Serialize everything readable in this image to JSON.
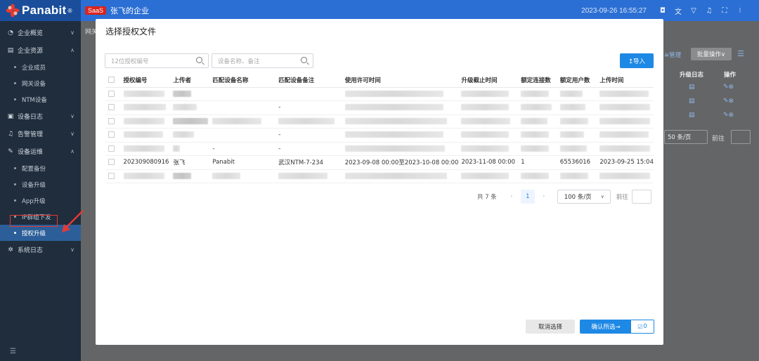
{
  "topbar": {
    "logo": "Panabit",
    "logo_reg": "®",
    "badge": "SaaS",
    "company": "张飞的企业",
    "datetime": "2023-09-26 16:55:27"
  },
  "sidebar": {
    "groups": [
      {
        "label": "企业概览",
        "icon": "gauge-icon"
      },
      {
        "label": "企业资源",
        "icon": "building-icon"
      },
      {
        "label": "设备日志",
        "icon": "log-icon"
      },
      {
        "label": "告警管理",
        "icon": "bell-icon"
      },
      {
        "label": "设备运维",
        "icon": "wrench-icon"
      },
      {
        "label": "系统日志",
        "icon": "gear-icon"
      }
    ],
    "resource_items": [
      "企业成员",
      "网关设备",
      "NTM设备"
    ],
    "ops_items": [
      "配置备份",
      "设备升级",
      "App升级",
      "IP群组下发",
      "授权升级"
    ],
    "bottom_icon": "menu-icon"
  },
  "background": {
    "breadcrumb": "网关",
    "manage_label": "≡管理",
    "batch_label": "批量操作∨",
    "col_upgrade_log": "升级日志",
    "col_ops": "操作",
    "page_size": "50 条/页",
    "goto": "前往"
  },
  "modal": {
    "title": "选择授权文件",
    "search1_placeholder": "12位授权编号",
    "search2_placeholder": "设备名称、备注",
    "import_label": "↥导入",
    "headers": [
      "授权编号",
      "上传者",
      "匹配设备名称",
      "匹配设备备注",
      "使用许可时间",
      "升级截止时间",
      "额定连接数",
      "额定用户数",
      "上传时间"
    ],
    "visible_row": {
      "id": "202309080916",
      "uploader": "张飞",
      "device_name": "Panabit",
      "device_note": "武汉NTM-7-234",
      "license_period": "2023-09-08 00:00至2023-10-08 00:00",
      "upgrade_deadline": "2023-11-08 00:00",
      "connections": "1",
      "users": "65536016",
      "upload_time": "2023-09-25 15:04"
    },
    "pagination": {
      "total": "共 7 条",
      "current_page": "1",
      "page_size": "100 条/页",
      "goto": "前往"
    },
    "cancel_label": "取消选择",
    "confirm_label": "确认所选→",
    "selected_count": "0"
  }
}
